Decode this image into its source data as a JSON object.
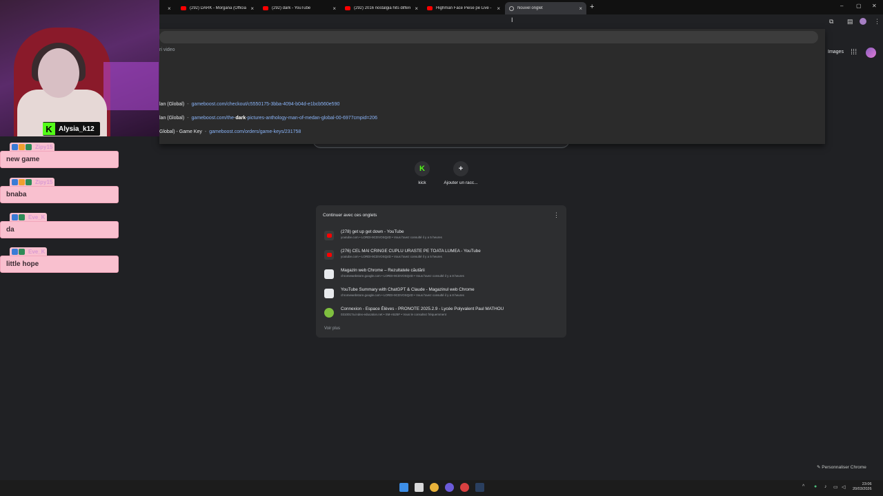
{
  "tabs": [
    {
      "label": "(292) DARK - Morgana (Official",
      "close": "×"
    },
    {
      "label": "(292) dark - YouTube",
      "close": "×"
    },
    {
      "label": "(292) 2016 nostalgia hits differe",
      "close": "×"
    },
    {
      "label": "Highman Face Piese pe Live - Y",
      "close": "×"
    },
    {
      "label": "Nouvel onglet",
      "close": "×"
    }
  ],
  "new_tab_label": "+",
  "window_controls": {
    "minimize": "–",
    "maximize": "▢",
    "close": "✕"
  },
  "omnibox": {
    "hint": "ri video",
    "suggestions": [
      {
        "title": "lan (Global)",
        "sep": "-",
        "url": "gameboost.com/checkout/c5550175-3bba-4094-b04d-e1bcb560e590"
      },
      {
        "title": "lan (Global)",
        "sep": "-",
        "url_pre": "gameboost.com/the-",
        "url_bold": "dark",
        "url_post": "-pictures-anthology-man-of-medan-global-00-6977cmpid=206"
      },
      {
        "title": "Global) - Game Key",
        "sep": "-",
        "url": "gameboost.com/orders/game-keys/231758"
      }
    ]
  },
  "header": {
    "images": "Images"
  },
  "shortcuts": [
    {
      "label": "kick",
      "glyph": "K"
    },
    {
      "label": "Ajouter un racc...",
      "glyph": "+"
    }
  ],
  "continue_card": {
    "title": "Continuer avec ces onglets",
    "menu": "⋮",
    "rows": [
      {
        "title": "(278) get up get down - YouTube",
        "sub": "youtube.com • LORDI-9CDVOSQ4D • Vous l'avez consulté il y a 5 heures",
        "icon": "youtube-icon"
      },
      {
        "title": "(276) CEL MAI CRINGE CUPLU URASTE PE TOATA LUMEA - YouTube",
        "sub": "youtube.com • LORDI-9CDVOSQ4D • Vous l'avez consulté il y a 5 heures",
        "icon": "youtube-icon"
      },
      {
        "title": "Magazin web Chrome – Rezultatele căutării",
        "sub": "chromewebstore.google.com • LORDI-9CDVOSQ4D • Vous l'avez consulté il y a 8 heures",
        "icon": "webstore-icon"
      },
      {
        "title": "YouTube Summary with ChatGPT & Claude - Magazinul web Chrome",
        "sub": "chromewebstore.google.com • LORDI-9CDVOSQ4D • Vous l'avez consulté il y a 8 heures",
        "icon": "webstore-icon"
      },
      {
        "title": "Connexion - Espace Élèves - PRONOTE 2025.2.9 - Lycée Polyvalent Paul MATHOU",
        "sub": "0310017a.index-education.net • SM-A525F • Vous le consultez fréquemment",
        "icon": "pronote-icon"
      }
    ],
    "more": "Voir plus"
  },
  "customize": "✎ Personnaliser Chrome",
  "clock": {
    "time": "23:06",
    "date": "20/03/2026"
  },
  "stream": {
    "streamer": "Alysia_k12",
    "kick_glyph": "K",
    "chat": [
      {
        "user": "Zipy15",
        "message": "new game"
      },
      {
        "user": "Zipy15",
        "message": "bnaba"
      },
      {
        "user": "Eve_K",
        "message": "da"
      },
      {
        "user": "Eve_K",
        "message": "little hope"
      }
    ]
  },
  "colors": {
    "accent_link": "#8ab4f8",
    "chat_bubble": "#f9c0cf",
    "kick_green": "#53fc18"
  }
}
